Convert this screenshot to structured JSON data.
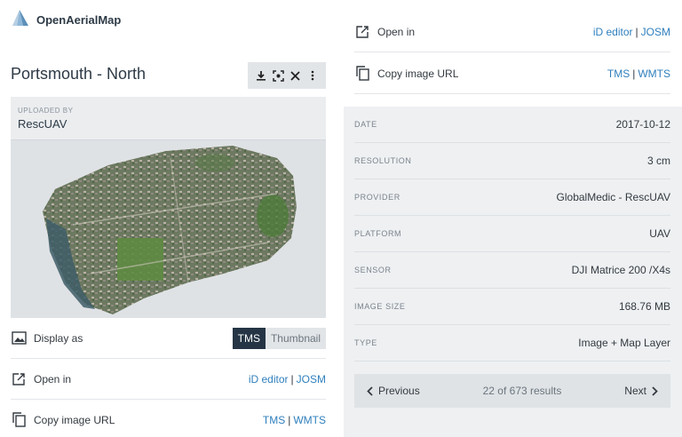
{
  "brand": {
    "name": "OpenAerialMap"
  },
  "image": {
    "title": "Portsmouth - North"
  },
  "uploader": {
    "label": "UPLOADED BY",
    "name": "RescUAV"
  },
  "display_as": {
    "label": "Display as",
    "options": [
      "TMS",
      "Thumbnail"
    ],
    "selected": "TMS"
  },
  "open_in": {
    "label": "Open in",
    "links": [
      "iD editor",
      "JOSM"
    ],
    "separator": "|"
  },
  "copy_url": {
    "label": "Copy image URL",
    "links": [
      "TMS",
      "WMTS"
    ],
    "separator": "|"
  },
  "metadata": [
    {
      "key": "DATE",
      "value": "2017-10-12"
    },
    {
      "key": "RESOLUTION",
      "value": "3 cm"
    },
    {
      "key": "PROVIDER",
      "value": "GlobalMedic - RescUAV"
    },
    {
      "key": "PLATFORM",
      "value": "UAV"
    },
    {
      "key": "SENSOR",
      "value": "DJI Matrice 200 /X4s"
    },
    {
      "key": "IMAGE SIZE",
      "value": "168.76 MB"
    },
    {
      "key": "TYPE",
      "value": "Image + Map Layer"
    }
  ],
  "pager": {
    "prev": "Previous",
    "next": "Next",
    "count": "22 of 673 results"
  },
  "icons": {
    "logo": "oam-logo-icon",
    "download": "download-icon",
    "focus": "focus-icon",
    "close": "close-icon",
    "more": "more-vertical-icon",
    "image": "image-icon",
    "open": "external-edit-icon",
    "copy": "copy-icon",
    "prev": "chevron-left-icon",
    "next": "chevron-right-icon"
  },
  "colors": {
    "accent": "#2f7fbd",
    "dark": "#253545",
    "panel": "#eef0f2"
  }
}
